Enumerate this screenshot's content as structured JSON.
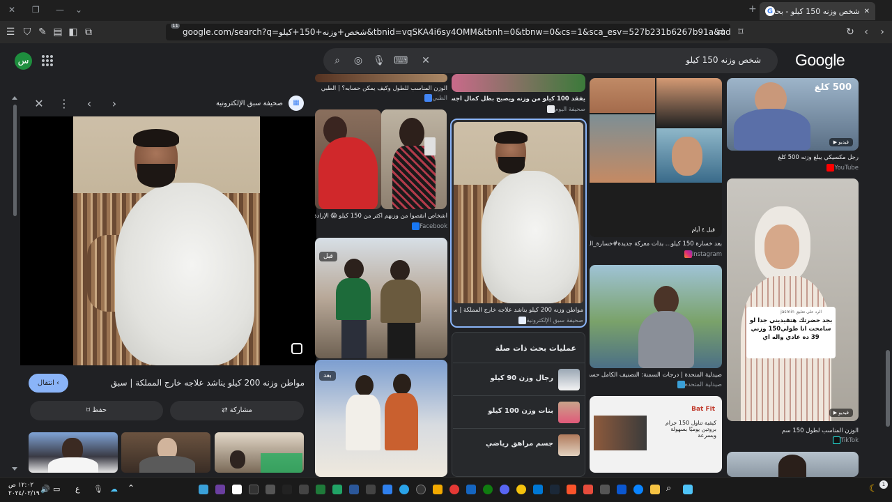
{
  "browser": {
    "tab_title": "شخص وزنه 150 كيلو - بحث Google",
    "tab_favicon": "G",
    "url": "google.com/search?q=شخص+وزنه+150+كيلو&tbnid=vqSKA4i6sy4OMM&tbnh=0&tbnw=0&cs=1&sca_esv=527b231b6267b91a&udm=2&biw=1699&bi...",
    "shield_count": "11"
  },
  "google": {
    "logo": "Google",
    "avatar_letter": "س",
    "query": "شخص وزنه 150 كيلو"
  },
  "viewer": {
    "site_name": "صحيفة سبق الإلكترونية",
    "title": "مواطن وزنه 200 كيلو يناشد علاجه خارج المملكة | سبق",
    "visit_label": "انتقال",
    "save_label": "حفظ",
    "share_label": "مشاركة"
  },
  "grid": {
    "col1": {
      "card0_caption": "الوزن المناسب للطول وكيف يمكن حسابه؟ | الطبي",
      "card0_source": "الطبي",
      "card1_caption": "أشخاص أنقصوا من وزنهم أكثر من 150 كيلو 😱 الإرادة ع...",
      "card1_source": "Facebook",
      "card2_badge": "قبل",
      "card3_badge": "بعد"
    },
    "col2": {
      "card0_caption": "يفقد 100 كيلو من وزنه ويصبح بطل كمال أجسام",
      "card0_source": "صحيفة اليوم",
      "card1_caption": "مواطن وزنه 200 كيلو يناشد علاجه خارج المملكة | سبق",
      "card1_source": "صحيفة سبق الإلكترونية",
      "related_title": "عمليات بحث ذات صلة",
      "related": [
        "رجال وزن 90 كيلو",
        "بنات وزن 100 كيلو",
        "جسم مراهق رياضي"
      ]
    },
    "col3": {
      "card0_overlay": "قبل ٤ أيام",
      "card0_caption": "بعد خسارة 150 كيلو... بدأت معركة جديدة#خسارة_الوزن...",
      "card0_source": "Instagram",
      "card1_caption": "صيدلية المتحدة | درجات السمنة: التصنيف الكامل حسب مؤشر...",
      "card1_source": "صيدلية المتحدة",
      "card2_text": "كيفية تناول 150 جرام بروتين يوميًا بسهولة وبسرعة",
      "card2_brand": "Bat Fit"
    },
    "col4": {
      "card0_badge": "500 كلغ",
      "card0_video": "فيديو",
      "card0_caption": "رجل مكسيكي يبلغ وزنه 500 كلغ",
      "card0_source": "YouTube",
      "card1_comment_head": "الرد على تعليق jasmin",
      "card1_comment": "بجد حضرتك هتفيديني جدا لو سامحت انا طولي150 وزني 39 ده عادي واله اي",
      "card1_video": "فيديو",
      "card1_caption": "الوزن المناسب لطول 150 سم",
      "card1_source": "TikTok"
    }
  },
  "taskbar": {
    "time": "١٢:٠٢ ص",
    "date": "٢٠٢٤/٠٢/١٩",
    "lang": "ع"
  },
  "colors": {
    "accent_blue": "#8ab4f8",
    "bg": "#202124",
    "avatar_green": "#1e8e3e"
  }
}
